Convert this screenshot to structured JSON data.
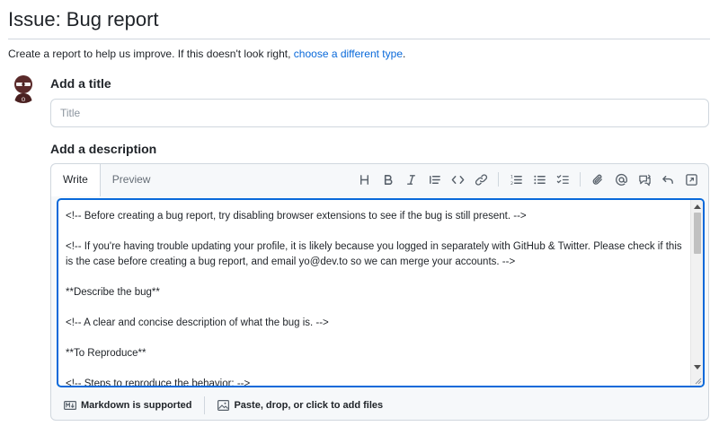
{
  "page": {
    "title": "Issue: Bug report",
    "subtitle_prefix": "Create a report to help us improve. If this doesn't look right, ",
    "subtitle_link": "choose a different type",
    "subtitle_suffix": "."
  },
  "title_section": {
    "label": "Add a title",
    "placeholder": "Title",
    "value": ""
  },
  "description_section": {
    "label": "Add a description",
    "tabs": [
      {
        "label": "Write",
        "active": true
      },
      {
        "label": "Preview",
        "active": false
      }
    ],
    "toolbar_icons": [
      "heading-icon",
      "bold-icon",
      "italic-icon",
      "quote-icon",
      "code-icon",
      "link-icon",
      "numbered-list-icon",
      "bullet-list-icon",
      "task-list-icon",
      "attach-icon",
      "mention-icon",
      "reference-icon",
      "undo-icon",
      "fullscreen-icon"
    ],
    "body": "<!-- Before creating a bug report, try disabling browser extensions to see if the bug is still present. -->\n\n<!-- If you're having trouble updating your profile, it is likely because you logged in separately with GitHub & Twitter. Please check if this is the case before creating a bug report, and email yo@dev.to so we can merge your accounts. -->\n\n**Describe the bug**\n\n<!-- A clear and concise description of what the bug is. -->\n\n**To Reproduce**\n\n<!-- Steps to reproduce the behavior: -->",
    "footer": {
      "markdown_label": "Markdown is supported",
      "attach_label": "Paste, drop, or click to add files"
    }
  },
  "colors": {
    "accent": "#0969da",
    "border": "#d0d7de",
    "muted": "#656d76"
  }
}
